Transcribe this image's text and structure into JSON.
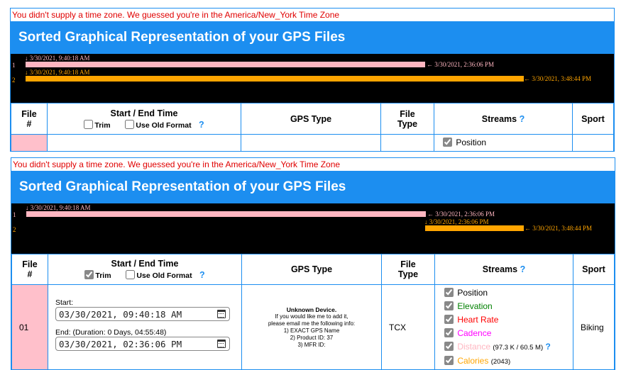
{
  "notice": "You didn't supply a time zone. We guessed you're in the America/New_York Time Zone",
  "section_title": "Sorted Graphical Representation of your GPS Files",
  "panel1": {
    "timeline": [
      {
        "row": "1",
        "start_label": "3/30/2021, 9:40:18 AM",
        "end_label": "3/30/2021, 2:36:06 PM",
        "color": "#ffb6c1"
      },
      {
        "row": "2",
        "start_label": "3/30/2021, 9:40:18 AM",
        "end_label": "3/30/2021, 3:48:44 PM",
        "color": "#ffa500"
      }
    ],
    "stream_first": "Position"
  },
  "panel2": {
    "timeline": [
      {
        "row": "1",
        "start_label": "3/30/2021, 9:40:18 AM",
        "end_label": "3/30/2021, 2:36:06 PM",
        "color": "#ffb6c1"
      },
      {
        "row": "2",
        "start_label": "3/30/2021, 2:36:06 PM",
        "end_label": "3/30/2021, 3:48:44 PM",
        "color": "#ffa500"
      }
    ]
  },
  "table": {
    "col_file": "File",
    "col_file_sub": "#",
    "col_time": "Start / End Time",
    "trim_label": "Trim",
    "old_format_label": "Use Old Format",
    "help_mark": "?",
    "col_gps": "GPS Type",
    "col_ftype": "File",
    "col_ftype_sub": "Type",
    "col_streams": "Streams",
    "col_sport": "Sport"
  },
  "row": {
    "file_num": "01",
    "start_label": "Start:",
    "start_value": "03/30/2021, 09:40:18 AM",
    "end_label": "End: (Duration: 0 Days, 04:55:48)",
    "end_value": "03/30/2021, 02:36:06 PM",
    "gps_title": "Unknown Device.",
    "gps_line1": "If you would like me to add it,",
    "gps_line2": "please email me the following info:",
    "gps_line3": "1) EXACT GPS Name",
    "gps_line4": "2) Product ID: 37",
    "gps_line5": "3) MFR ID:",
    "file_type": "TCX",
    "sport": "Biking",
    "streams": [
      {
        "label": "Position",
        "color": "#000000",
        "extra": ""
      },
      {
        "label": "Elevation",
        "color": "#008000",
        "extra": ""
      },
      {
        "label": "Heart Rate",
        "color": "#ff0000",
        "extra": ""
      },
      {
        "label": "Cadence",
        "color": "#ff00ff",
        "extra": ""
      },
      {
        "label": "Distance",
        "color": "#ffb6c1",
        "extra": "(97.3 K / 60.5 M)"
      },
      {
        "label": "Calories",
        "color": "#ffa500",
        "extra": "(2043)"
      }
    ]
  },
  "colors": {
    "accent": "#1c8ef0",
    "notice": "#e00000",
    "file_cell": "#ffc0cb"
  }
}
